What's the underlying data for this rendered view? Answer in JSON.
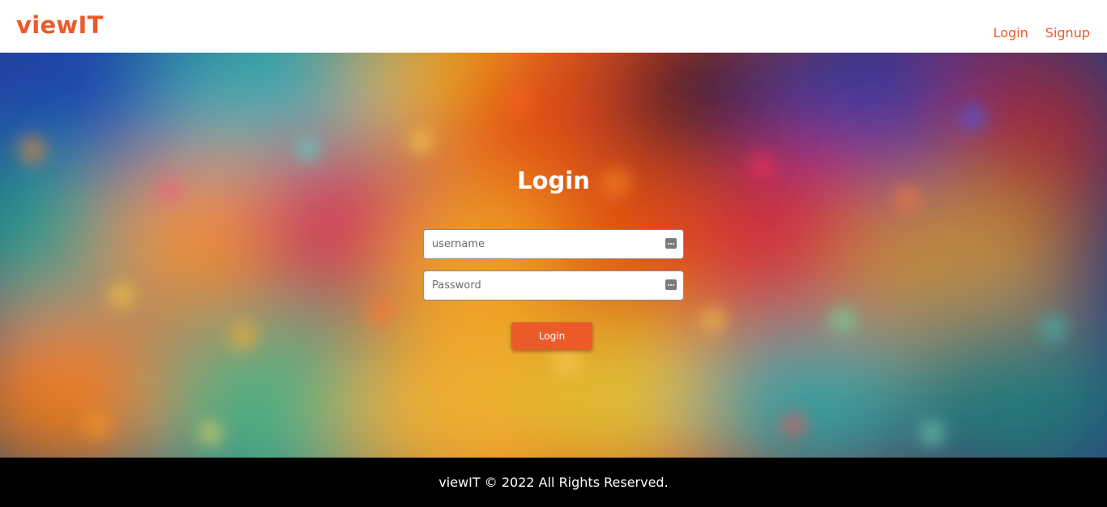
{
  "brand": {
    "name": "viewIT",
    "color": "#EB5A2A"
  },
  "nav": {
    "login": "Login",
    "signup": "Signup"
  },
  "form": {
    "title": "Login",
    "username_placeholder": "username",
    "password_placeholder": "Password",
    "submit_label": "Login",
    "field_icon": "password-manager-key-icon"
  },
  "footer": {
    "text": "viewIT © 2022 All Rights Reserved."
  },
  "colors": {
    "accent": "#EB5A2A",
    "footer_bg": "#000000",
    "header_bg": "#FFFFFF"
  }
}
